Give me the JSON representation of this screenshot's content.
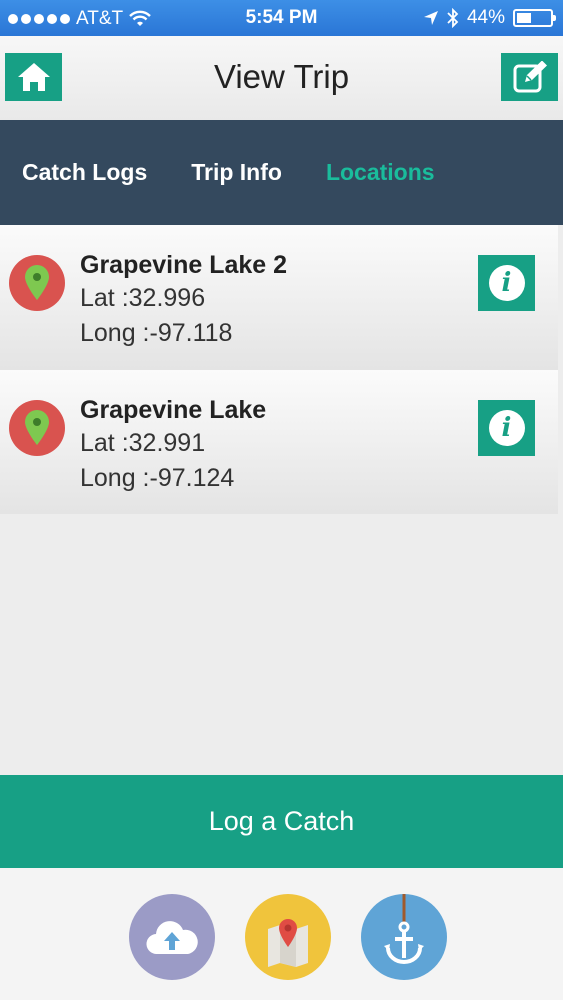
{
  "status_bar": {
    "carrier": "AT&T",
    "time": "5:54 PM",
    "battery": "44%",
    "battery_level": 0.44
  },
  "header": {
    "title": "View Trip",
    "left_icon": "home-icon",
    "right_icon": "edit-icon"
  },
  "tabs": [
    {
      "label": "Catch Logs",
      "active": false
    },
    {
      "label": "Trip Info",
      "active": false
    },
    {
      "label": "Locations",
      "active": true
    }
  ],
  "locations": [
    {
      "name": "Grapevine Lake 2",
      "lat": "Lat :32.996",
      "long": "Long :-97.118"
    },
    {
      "name": "Grapevine Lake",
      "lat": "Lat :32.991",
      "long": "Long :-97.124"
    }
  ],
  "actions": {
    "log_catch": "Log a Catch"
  },
  "bottom_nav": [
    {
      "icon": "cloud-upload-icon"
    },
    {
      "icon": "map-pin-icon"
    },
    {
      "icon": "anchor-icon"
    }
  ],
  "colors": {
    "accent": "#17a085",
    "tab_bar": "#34495e",
    "active_tab": "#1abc9c",
    "pin_circle": "#d9534f",
    "pin": "#7ec850"
  }
}
